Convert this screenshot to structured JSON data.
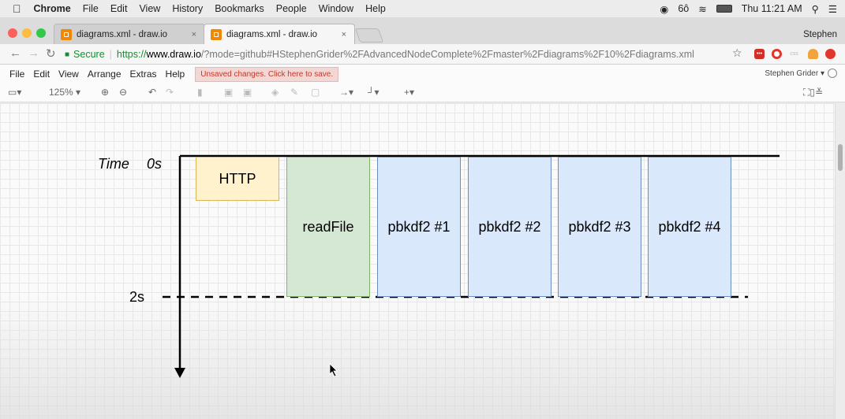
{
  "menubar": {
    "apple_icon": "apple-icon",
    "items": [
      "Chrome",
      "File",
      "Edit",
      "View",
      "History",
      "Bookmarks",
      "People",
      "Window",
      "Help"
    ],
    "clock": "Thu 11:21 AM"
  },
  "browser": {
    "tabs": [
      {
        "title": "diagrams.xml - draw.io",
        "close": "×"
      },
      {
        "title": "diagrams.xml - draw.io",
        "close": "×"
      }
    ],
    "profile": "Stephen",
    "url_secure_label": "Secure",
    "url_scheme": "https://",
    "url_host": "www.draw.io",
    "url_path": "/?mode=github#HStephenGrider%2FAdvancedNodeComplete%2Fmaster%2Fdiagrams%2F10%2Fdiagrams.xml"
  },
  "app": {
    "menu": [
      "File",
      "Edit",
      "View",
      "Arrange",
      "Extras",
      "Help"
    ],
    "unsaved_notice": "Unsaved changes. Click here to save.",
    "user": "Stephen Grider ▾",
    "zoom": "125% ▾"
  },
  "diagram": {
    "time_label": "Time",
    "start_label": "0s",
    "end_label": "2s",
    "boxes": [
      {
        "label": "HTTP",
        "fill": "#fff2cc",
        "stroke": "#d6b656"
      },
      {
        "label": "readFile",
        "fill": "#d5e8d4",
        "stroke": "#82b366"
      },
      {
        "label": "pbkdf2 #1",
        "fill": "#dae8fc",
        "stroke": "#6c8ebf"
      },
      {
        "label": "pbkdf2 #2",
        "fill": "#dae8fc",
        "stroke": "#6c8ebf"
      },
      {
        "label": "pbkdf2 #3",
        "fill": "#dae8fc",
        "stroke": "#6c8ebf"
      },
      {
        "label": "pbkdf2 #4",
        "fill": "#dae8fc",
        "stroke": "#6c8ebf"
      }
    ]
  },
  "colors": {
    "unsaved_bg": "#f3d7d4",
    "secure_green": "#1a8a34",
    "drawio_orange": "#f08705"
  }
}
